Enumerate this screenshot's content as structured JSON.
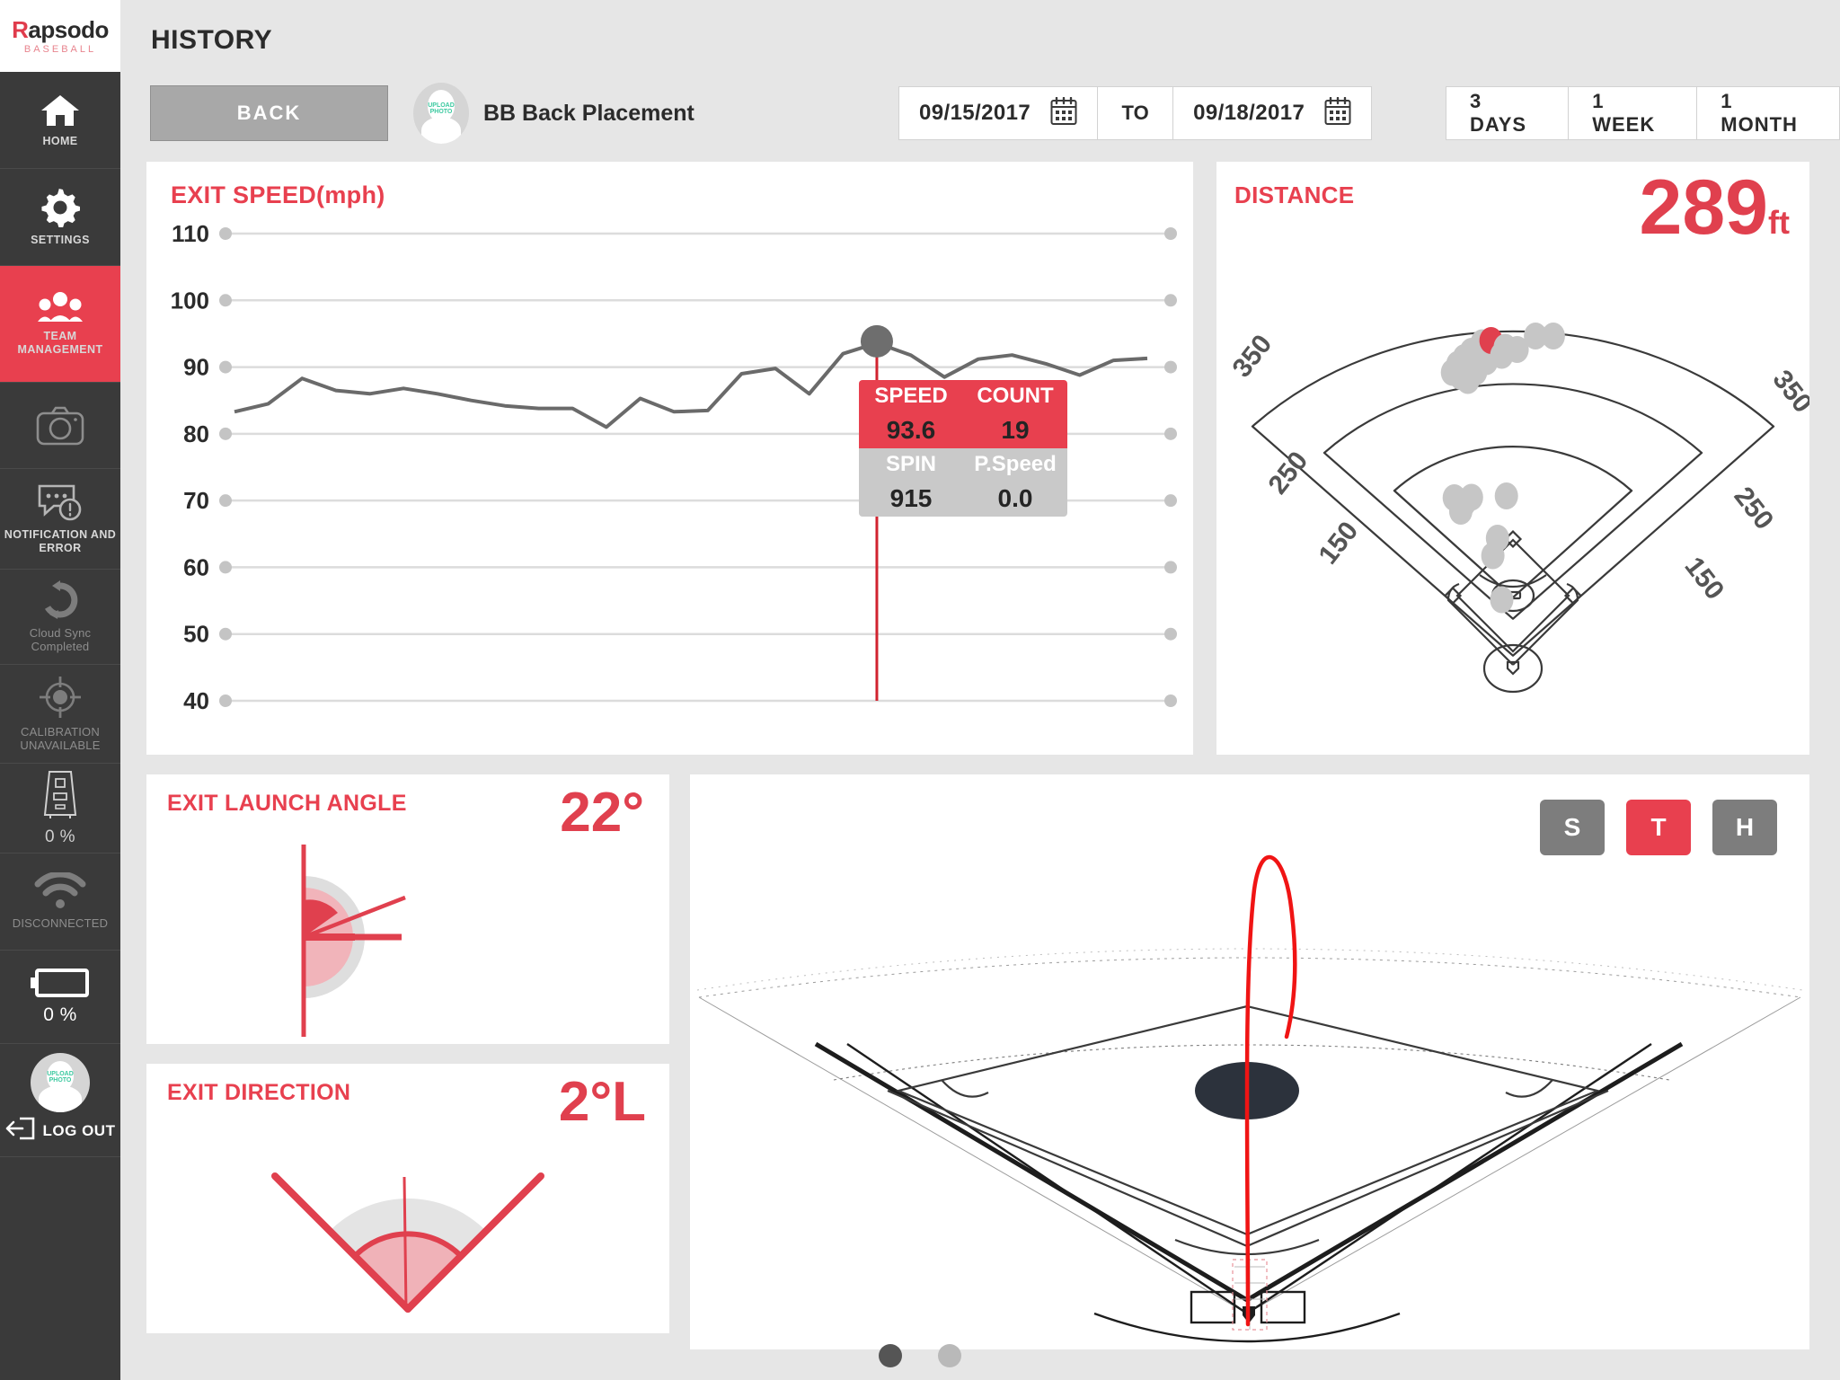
{
  "brand": {
    "name_prefix": "R",
    "name_rest": "apsodo",
    "sub": "BASEBALL"
  },
  "sidebar": {
    "items": [
      {
        "label": "HOME",
        "icon": "home-icon",
        "state": "normal"
      },
      {
        "label": "SETTINGS",
        "icon": "gear-icon",
        "state": "normal"
      },
      {
        "label": "TEAM MANAGEMENT",
        "icon": "people-icon",
        "state": "active"
      },
      {
        "label": "",
        "icon": "camera-icon",
        "state": "dim"
      },
      {
        "label": "NOTIFICATION AND ERROR",
        "icon": "notification-error-icon",
        "state": "normal"
      },
      {
        "label": "Cloud Sync Completed",
        "icon": "cloud-sync-icon",
        "state": "dim"
      },
      {
        "label": "CALIBRATION UNAVAILABLE",
        "icon": "calibration-target-icon",
        "state": "dim"
      },
      {
        "label": "0 %",
        "icon": "device-icon",
        "state": "pct"
      },
      {
        "label": "DISCONNECTED",
        "icon": "wifi-icon",
        "state": "dim"
      },
      {
        "label": "0 %",
        "icon": "battery-icon",
        "state": "battery"
      }
    ],
    "logout": {
      "label": "LOG OUT",
      "icon": "logout-icon",
      "avatar_text_1": "UPLOAD",
      "avatar_text_2": "PHOTO"
    }
  },
  "header": {
    "title": "HISTORY",
    "back_label": "BACK",
    "player_name": "BB Back Placement",
    "avatar_text_1": "UPLOAD",
    "avatar_text_2": "PHOTO",
    "date_from": "09/15/2017",
    "date_to": "09/18/2017",
    "to_label": "TO",
    "from_icon": "calendar-icon",
    "to_icon": "calendar-icon",
    "ranges": [
      {
        "label": "3 DAYS",
        "selected": false
      },
      {
        "label": "1 WEEK",
        "selected": false
      },
      {
        "label": "1 MONTH",
        "selected": false
      }
    ]
  },
  "exit_speed_card": {
    "title": "EXIT SPEED(mph)",
    "tooltip": {
      "speed_label": "SPEED",
      "speed_value": "93.6",
      "count_label": "COUNT",
      "count_value": "19",
      "spin_label": "SPIN",
      "spin_value": "915",
      "pspeed_label": "P.Speed",
      "pspeed_value": "0.0"
    }
  },
  "distance_card": {
    "title": "DISTANCE",
    "value": "289",
    "unit": "ft",
    "ring_labels": [
      "350",
      "250",
      "150",
      "150",
      "250",
      "350"
    ]
  },
  "launch_angle_card": {
    "title": "EXIT LAUNCH ANGLE",
    "value": "22°"
  },
  "direction_card": {
    "title": "EXIT DIRECTION",
    "value": "2°L"
  },
  "trajectory_card": {
    "buttons": [
      {
        "label": "S",
        "selected": false
      },
      {
        "label": "T",
        "selected": true
      },
      {
        "label": "H",
        "selected": false
      }
    ]
  },
  "pager": {
    "pages": 2,
    "active": 0
  },
  "colors": {
    "accent": "#e8404f",
    "accent_dark": "#e0404e",
    "sidebar_bg": "#3a3a3a",
    "page_bg": "#e6e6e6",
    "card_bg": "#ffffff",
    "tooltip_gray": "#c9c9c9",
    "line_gray": "#6a6a6a",
    "dot_gray": "#c4c4c4"
  },
  "chart_data": {
    "type": "line",
    "title": "EXIT SPEED(mph)",
    "xlabel": "",
    "ylabel": "Exit Speed (mph)",
    "ylim": [
      40,
      110
    ],
    "yticks": [
      110,
      100,
      90,
      80,
      70,
      60,
      50,
      40
    ],
    "grid": true,
    "legend": "none",
    "marker_index": 19,
    "marker_value": 93.6,
    "values": [
      83.3,
      84.5,
      88.3,
      86.5,
      86.0,
      86.8,
      86.0,
      85.0,
      84.2,
      83.8,
      83.8,
      81.0,
      85.3,
      83.3,
      83.5,
      89.0,
      89.8,
      86.0,
      92.0,
      93.6,
      91.8,
      88.5,
      91.2,
      91.8,
      90.5,
      88.8,
      91.0,
      91.3
    ],
    "annotations": {
      "speed": 93.6,
      "count": 19,
      "spin": 915,
      "p_speed": 0.0
    },
    "secondary": {
      "type": "scatter",
      "title": "DISTANCE spray chart",
      "distance_rings": [
        150,
        250,
        350
      ],
      "highlight_value": 289,
      "highlight_unit": "ft",
      "points": [
        {
          "x": 0.455,
          "y": 0.205,
          "hit": false
        },
        {
          "x": 0.47,
          "y": 0.175,
          "hit": false
        },
        {
          "x": 0.448,
          "y": 0.163,
          "hit": false
        },
        {
          "x": 0.43,
          "y": 0.182,
          "hit": false
        },
        {
          "x": 0.418,
          "y": 0.196,
          "hit": false
        },
        {
          "x": 0.407,
          "y": 0.211,
          "hit": false
        },
        {
          "x": 0.398,
          "y": 0.229,
          "hit": false
        },
        {
          "x": 0.412,
          "y": 0.238,
          "hit": false
        },
        {
          "x": 0.424,
          "y": 0.247,
          "hit": false
        },
        {
          "x": 0.437,
          "y": 0.228,
          "hit": false
        },
        {
          "x": 0.463,
          "y": 0.158,
          "hit": true
        },
        {
          "x": 0.487,
          "y": 0.173,
          "hit": false
        },
        {
          "x": 0.481,
          "y": 0.191,
          "hit": false
        },
        {
          "x": 0.507,
          "y": 0.178,
          "hit": false
        },
        {
          "x": 0.538,
          "y": 0.148,
          "hit": false
        },
        {
          "x": 0.568,
          "y": 0.148,
          "hit": false
        },
        {
          "x": 0.401,
          "y": 0.508,
          "hit": false
        },
        {
          "x": 0.418,
          "y": 0.52,
          "hit": false
        },
        {
          "x": 0.412,
          "y": 0.538,
          "hit": false
        },
        {
          "x": 0.43,
          "y": 0.507,
          "hit": false
        },
        {
          "x": 0.489,
          "y": 0.504,
          "hit": false
        },
        {
          "x": 0.474,
          "y": 0.598,
          "hit": false
        },
        {
          "x": 0.466,
          "y": 0.637,
          "hit": false
        },
        {
          "x": 0.481,
          "y": 0.735,
          "hit": false
        }
      ]
    }
  }
}
